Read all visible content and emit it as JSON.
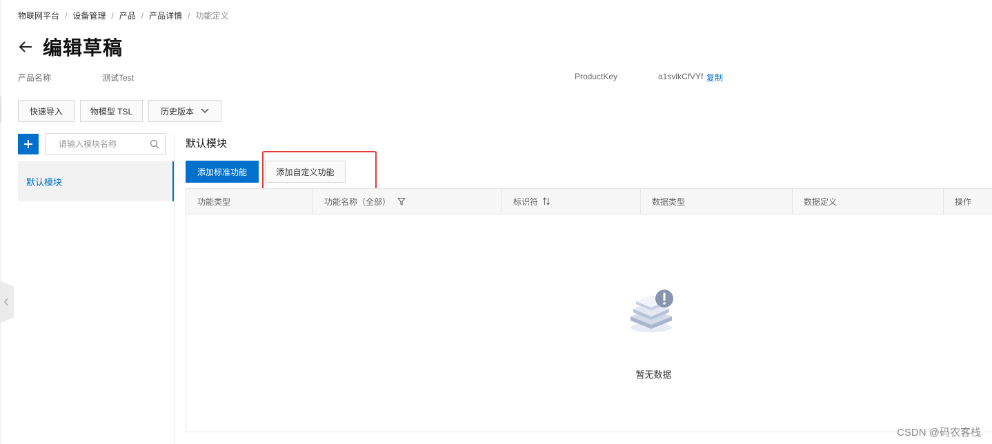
{
  "breadcrumb": [
    "物联网平台",
    "设备管理",
    "产品",
    "产品详情",
    "功能定义"
  ],
  "breadcrumb_separator": "/",
  "page_title": "编辑草稿",
  "product": {
    "name_label": "产品名称",
    "name_value": "测试Test",
    "key_label": "ProductKey",
    "key_value": "a1svlkCfVYf",
    "copy_label": "复制"
  },
  "toolbar": {
    "quick_import": "快速导入",
    "tsl_model": "物模型 TSL",
    "history_version": "历史版本"
  },
  "modules": {
    "search_placeholder": "请输入模块名称",
    "items": [
      "默认模块"
    ]
  },
  "section": {
    "title": "默认模块",
    "add_standard": "添加标准功能",
    "add_custom": "添加自定义功能"
  },
  "table": {
    "columns": [
      "功能类型",
      "功能名称（全部）",
      "标识符",
      "数据类型",
      "数据定义",
      "操作"
    ],
    "empty_text": "暂无数据"
  },
  "watermark": "CSDN @码农客栈",
  "colors": {
    "primary": "#0070cc",
    "highlight": "#e53935"
  }
}
